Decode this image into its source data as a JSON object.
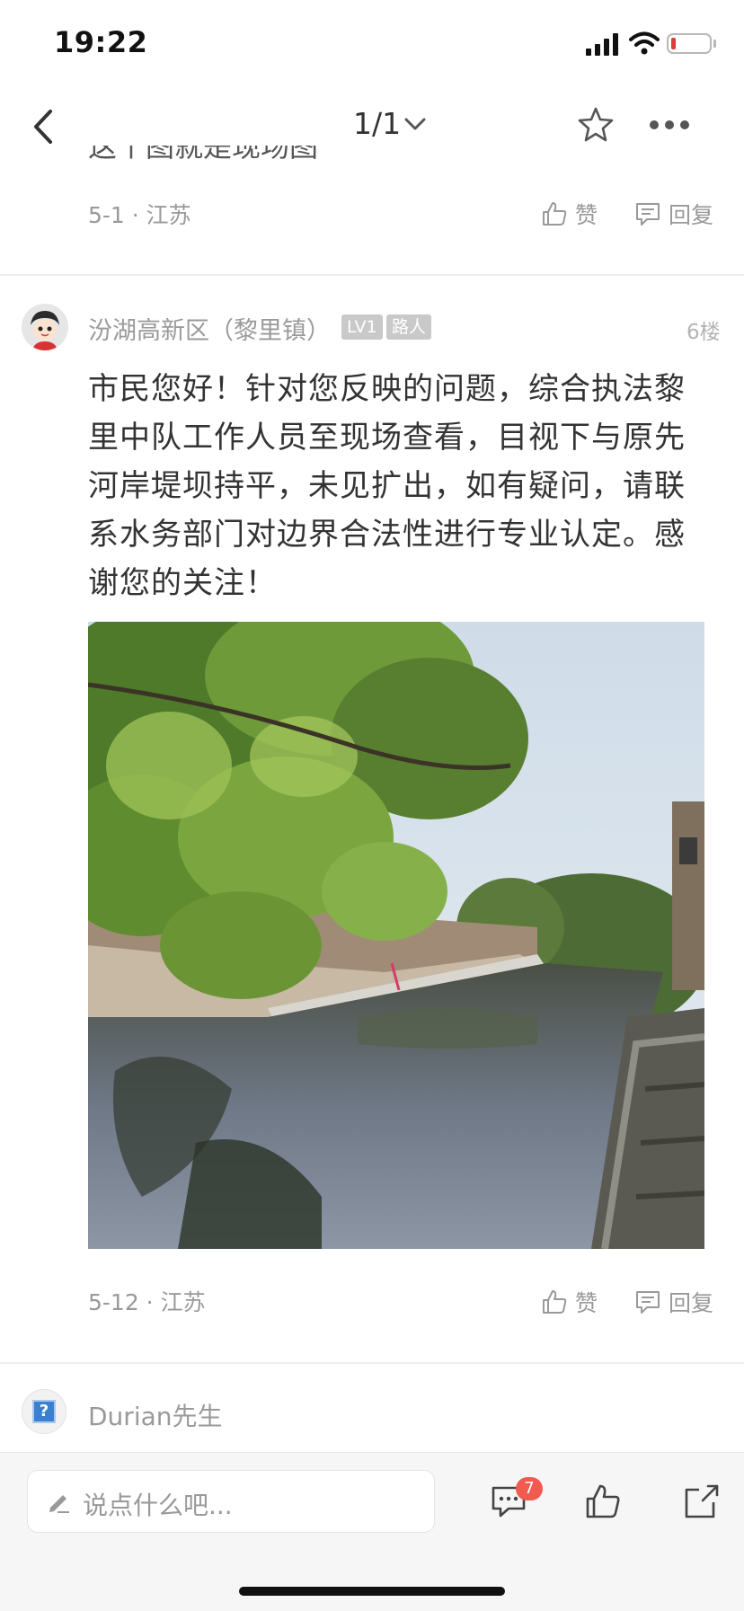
{
  "status_bar": {
    "time": "19:22"
  },
  "nav": {
    "page_indicator": "1/1"
  },
  "previous_comment": {
    "partial_text": "这个图就是现场图",
    "date_location": "5-1 · 江苏",
    "like_label": "赞",
    "reply_label": "回复"
  },
  "reply": {
    "author": "汾湖高新区（黎里镇）",
    "level_badge": "LV1",
    "role_badge": "路人",
    "floor": "6楼",
    "text": "市民您好！针对您反映的问题，综合执法黎里中队工作人员至现场查看，目视下与原先河岸堤坝持平，未见扩出，如有疑问，请联系水务部门对边界合法性进行专业认定。感谢您的关注！",
    "date_location": "5-12 · 江苏",
    "like_label": "赞",
    "reply_label": "回复"
  },
  "next_comment": {
    "author": "Durian先生"
  },
  "bottom_bar": {
    "input_placeholder": "说点什么吧...",
    "comment_count": "7"
  },
  "colors": {
    "accent_red": "#f05a4f",
    "muted_text": "#999999"
  }
}
